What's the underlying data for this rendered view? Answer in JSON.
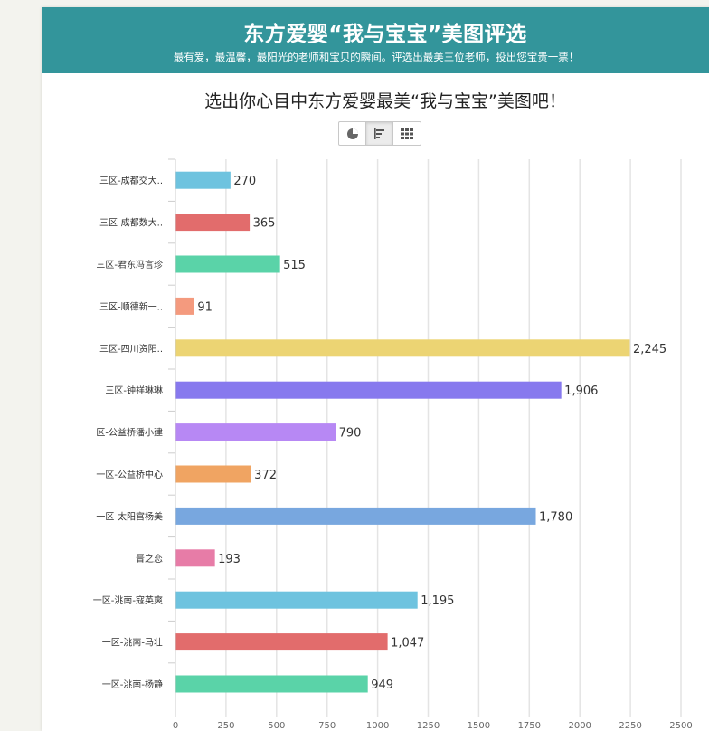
{
  "header": {
    "title": "东方爱婴“我与宝宝”美图评选",
    "subtitle": "最有爱，最温馨，最阳光的老师和宝贝的瞬间。评选出最美三位老师，投出您宝贵一票！"
  },
  "view_toggle": {
    "options": [
      "pie-chart-icon",
      "bar-chart-icon",
      "grid-icon"
    ],
    "active": "bar-chart-icon"
  },
  "chart_data": {
    "type": "bar",
    "orientation": "horizontal",
    "title": "选出你心目中东方爱婴最美“我与宝宝”美图吧！",
    "categories": [
      "三区-成都交大..",
      "三区-成都数大..",
      "三区-君东冯言珍",
      "三区-顺德新一..",
      "三区-四川资阳..",
      "三区-钟祥琳琳",
      "一区-公益桥潘小建",
      "一区-公益桥中心",
      "一区-太阳宫杨美",
      "晋之恋",
      "一区-洮南-寇英爽",
      "一区-洮南-马壮",
      "一区-洮南-杨静"
    ],
    "values": [
      270,
      365,
      515,
      91,
      2245,
      1906,
      790,
      372,
      1780,
      193,
      1195,
      1047,
      949
    ],
    "value_labels": [
      "270",
      "365",
      "515",
      "91",
      "2,245",
      "1,906",
      "790",
      "372",
      "1,780",
      "193",
      "1,195",
      "1,047",
      "949"
    ],
    "colors": [
      "#6ec3df",
      "#e26c6c",
      "#5ad3a8",
      "#f49a7e",
      "#ecd473",
      "#8779ee",
      "#b788f4",
      "#f0a462",
      "#78a7df",
      "#e77ca7",
      "#6ec3df",
      "#e26c6c",
      "#5ad3a8"
    ],
    "xticks": [
      "0",
      "250",
      "500",
      "750",
      "1000",
      "1250",
      "1500",
      "1750",
      "2000",
      "2250",
      "2500"
    ],
    "xlim": [
      0,
      2500
    ],
    "grid": true
  }
}
